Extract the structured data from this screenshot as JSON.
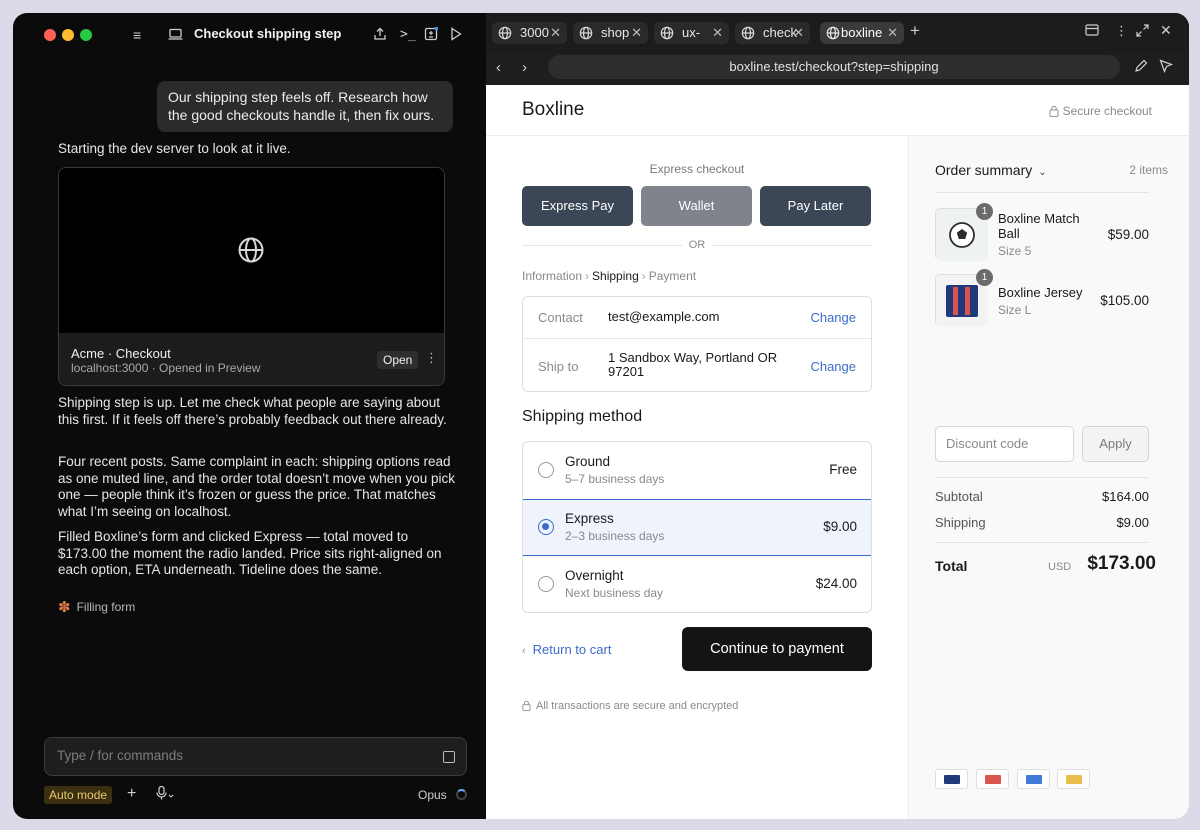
{
  "left": {
    "window_title": "Checkout shipping step",
    "user_message": "Our shipping step feels off. Research how the good checkouts handle it, then fix ours.",
    "msg_dev_server": "Starting the dev server to look at it live.",
    "preview": {
      "title": "Acme · Checkout",
      "subtitle": "localhost:3000 · Opened in Preview",
      "open_label": "Open",
      "more": "⋮"
    },
    "msg_shipping_up": "Shipping step is up. Let me check what people are saying about this first. If it feels off there’s probably feedback out there already.",
    "msg_posts": "Four recent posts. Same complaint in each: shipping options read as one muted line, and the order total doesn’t move when you pick one — people think it’s frozen or guess the price. That matches what I’m seeing on localhost.",
    "msg_filled": "Filled Boxline’s form and clicked Express — total moved to $173.00 the moment the radio landed. Price sits right-aligned on each option, ETA underneath. Tideline does the same.",
    "status": "Filling form",
    "input_placeholder": "Type / for commands",
    "auto_mode": "Auto mode",
    "model": "Opus"
  },
  "browser": {
    "tabs": [
      {
        "label": "3000"
      },
      {
        "label": "shop"
      },
      {
        "label": "ux-"
      },
      {
        "label": "check"
      },
      {
        "label": "boxline"
      }
    ],
    "url": "boxline.test/checkout?step=shipping"
  },
  "checkout": {
    "brand": "Boxline",
    "secure": "Secure checkout",
    "express_title": "Express checkout",
    "express_buttons": [
      {
        "label": "Express Pay",
        "color": "#3b4656"
      },
      {
        "label": "Wallet",
        "color": "#7f838c"
      },
      {
        "label": "Pay Later",
        "color": "#3b4656"
      }
    ],
    "or": "OR",
    "breadcrumb": {
      "info": "Information",
      "shipping": "Shipping",
      "payment": "Payment",
      "sep": "›"
    },
    "contact": {
      "label": "Contact",
      "value": "test@example.com",
      "change": "Change"
    },
    "ship_to": {
      "label": "Ship to",
      "value": "1 Sandbox Way, Portland OR 97201",
      "change": "Change"
    },
    "shipping_title": "Shipping method",
    "options": [
      {
        "name": "Ground",
        "eta": "5–7 business days",
        "price": "Free"
      },
      {
        "name": "Express",
        "eta": "2–3 business days",
        "price": "$9.00"
      },
      {
        "name": "Overnight",
        "eta": "Next business day",
        "price": "$24.00"
      }
    ],
    "return_label": "Return to cart",
    "continue_label": "Continue to payment",
    "footnote": "All transactions are secure and encrypted"
  },
  "summary": {
    "title": "Order summary",
    "count": "2 items",
    "items": [
      {
        "name": "Boxline Match Ball",
        "size": "Size 5",
        "price": "$59.00",
        "qty": "1"
      },
      {
        "name": "Boxline Jersey",
        "size": "Size L",
        "price": "$105.00",
        "qty": "1"
      }
    ],
    "discount_placeholder": "Discount code",
    "apply": "Apply",
    "subtotal_label": "Subtotal",
    "subtotal": "$164.00",
    "shipping_label": "Shipping",
    "shipping": "$9.00",
    "total_label": "Total",
    "currency": "USD",
    "total": "$173.00",
    "payment_colors": [
      "#1f3a7a",
      "#d9534f",
      "#3f7bd6",
      "#e9bd4c"
    ]
  },
  "colors": {
    "accent": "#3b6cc9",
    "selected_bg": "#eef3fc"
  }
}
